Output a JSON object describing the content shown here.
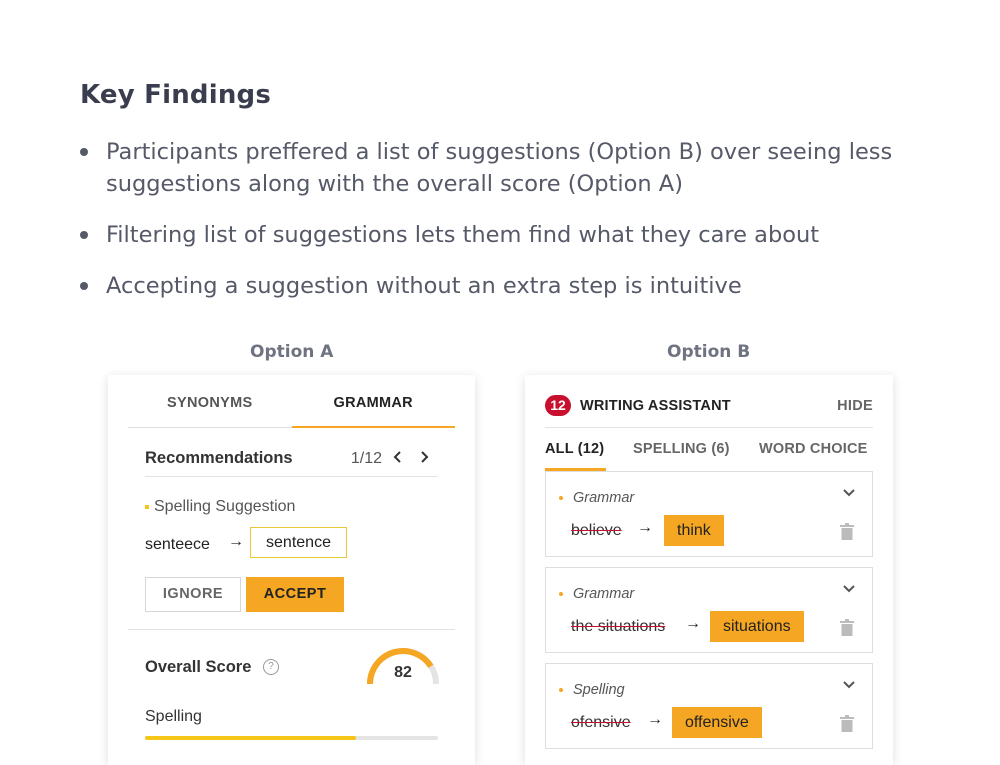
{
  "heading": "Key Findings",
  "findings": [
    "Participants preffered a list of suggestions (Option B) over seeing less suggestions along with the overall score (Option A)",
    "Filtering list of suggestions lets them find what they care about",
    "Accepting a suggestion without an extra step is intuitive"
  ],
  "option_a": {
    "label": "Option A",
    "tabs": [
      "SYNONYMS",
      "GRAMMAR"
    ],
    "active_tab": "GRAMMAR",
    "recommendations": {
      "title": "Recommendations",
      "page": "1/12"
    },
    "suggestion": {
      "type": "Spelling Suggestion",
      "from": "senteece",
      "arrow": "→",
      "to": "sentence"
    },
    "buttons": {
      "ignore": "IGNORE",
      "accept": "ACCEPT"
    },
    "score": {
      "title": "Overall Score",
      "help": "?",
      "value": "82",
      "value_fraction": 0.82
    },
    "spelling": {
      "label": "Spelling",
      "progress_fraction": 0.72
    },
    "colors": {
      "accent": "#f5a623",
      "yellow": "#f5c518"
    }
  },
  "option_b": {
    "label": "Option B",
    "badge": "12",
    "title": "WRITING ASSISTANT",
    "hide": "HIDE",
    "filters": [
      "ALL (12)",
      "SPELLING (6)",
      "WORD CHOICE"
    ],
    "active_filter": "ALL (12)",
    "suggestions": [
      {
        "type": "Grammar",
        "from": "believe",
        "arrow": "→",
        "to": "think"
      },
      {
        "type": "Grammar",
        "from": "the situations",
        "arrow": "→",
        "to": "situations"
      },
      {
        "type": "Spelling",
        "from": "ofensive",
        "arrow": "→",
        "to": "offensive"
      }
    ],
    "icons": {
      "expand": "chevron-down-icon",
      "delete": "trash-icon"
    },
    "colors": {
      "badge": "#c8102e",
      "accent": "#f5a623"
    }
  }
}
